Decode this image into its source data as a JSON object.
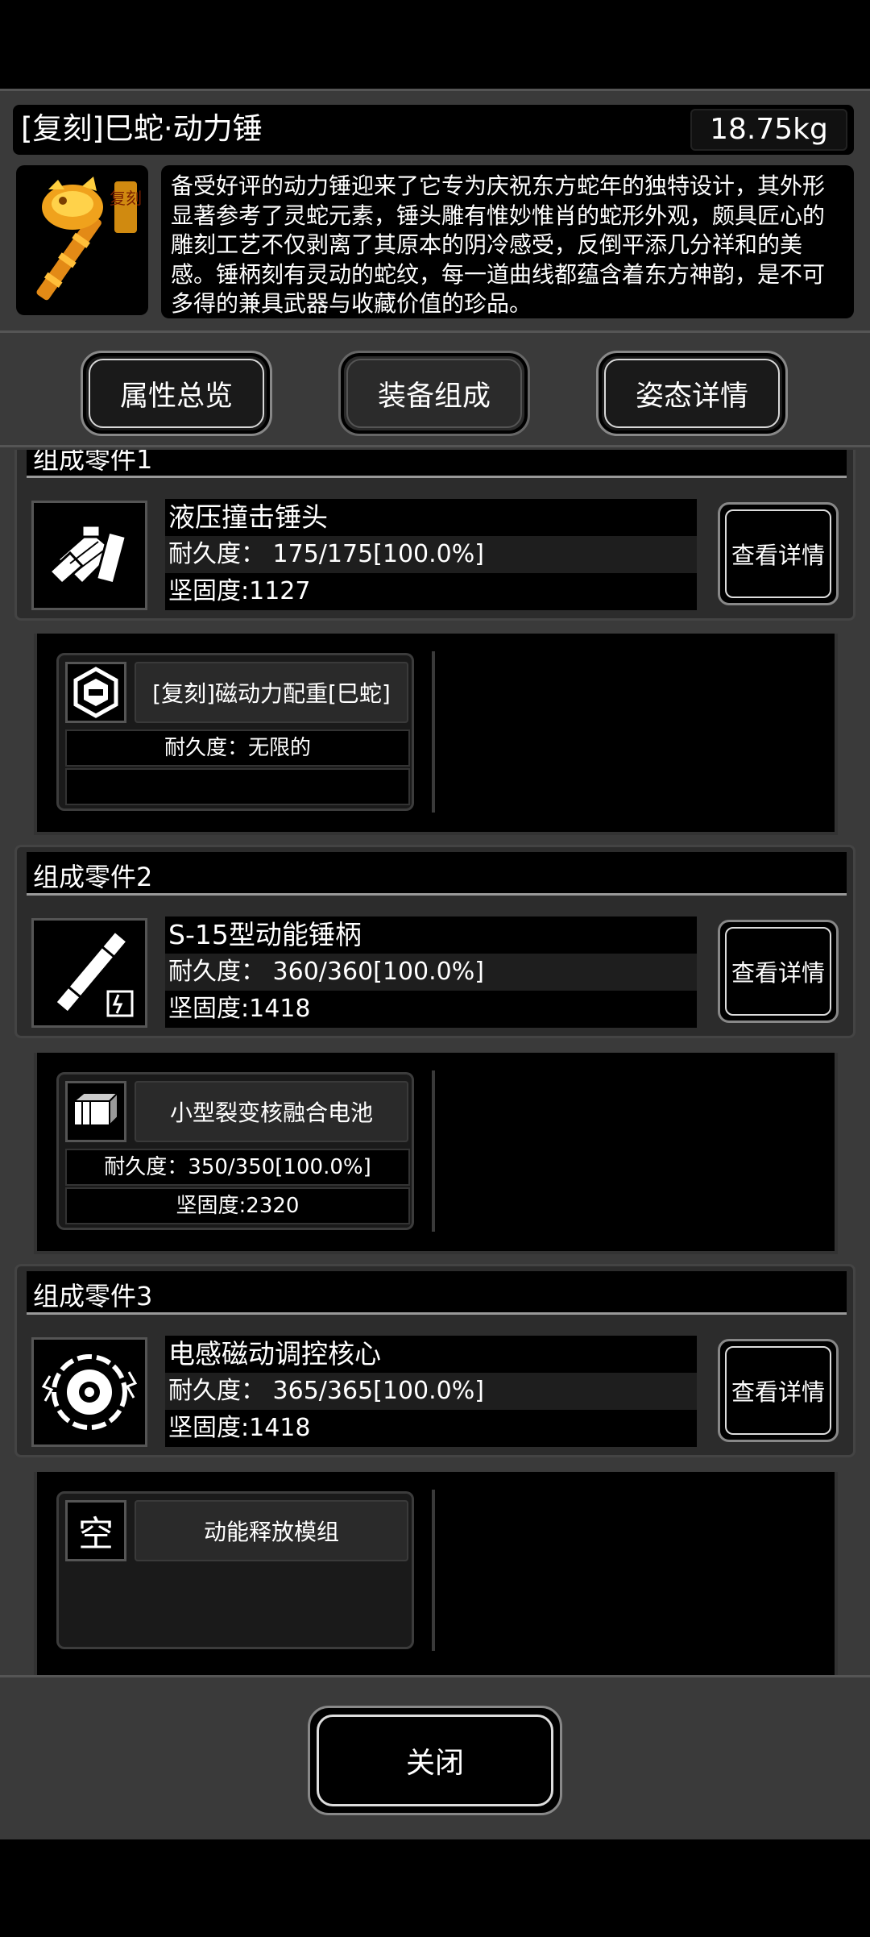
{
  "header": {
    "item_name": "[复刻]巳蛇·动力锤",
    "weight": "18.75kg",
    "item_badge": "复刻"
  },
  "description": "备受好评的动力锤迎来了它专为庆祝东方蛇年的独特设计，其外形显著参考了灵蛇元素，锤头雕有惟妙惟肖的蛇形外观，颇具匠心的雕刻工艺不仅剥离了其原本的阴冷感受，反倒平添几分祥和的美感。锤柄刻有灵动的蛇纹，每一道曲线都蕴含着东方神韵，是不可多得的兼具武器与收藏价值的珍品。",
  "tabs": [
    {
      "label": "属性总览",
      "active": false
    },
    {
      "label": "装备组成",
      "active": true
    },
    {
      "label": "姿态详情",
      "active": false
    }
  ],
  "parts": [
    {
      "header": "组成零件1",
      "name": "液压撞击锤头",
      "durability": "耐久度：  175/175[100.0%]",
      "firmness": "坚固度:1127",
      "detail_label": "查看详情",
      "icon": "hammer-head-icon",
      "sub": {
        "icon": "magnet-module-icon",
        "name": "[复刻]磁动力配重[巳蛇]",
        "row1": "耐久度：无限的",
        "row2": ""
      }
    },
    {
      "header": "组成零件2",
      "name": "S-15型动能锤柄",
      "durability": "耐久度：  360/360[100.0%]",
      "firmness": "坚固度:1418",
      "detail_label": "查看详情",
      "icon": "hammer-handle-icon",
      "sub": {
        "icon": "battery-icon",
        "name": "小型裂变核融合电池",
        "row1": "耐久度：350/350[100.0%]",
        "row2": "坚固度:2320"
      }
    },
    {
      "header": "组成零件3",
      "name": "电感磁动调控核心",
      "durability": "耐久度：  365/365[100.0%]",
      "firmness": "坚固度:1418",
      "detail_label": "查看详情",
      "icon": "core-icon",
      "sub": {
        "icon": "empty-slot-icon",
        "empty_glyph": "空",
        "name": "动能释放模组",
        "row1": "",
        "row2": ""
      }
    }
  ],
  "close_label": "关闭"
}
